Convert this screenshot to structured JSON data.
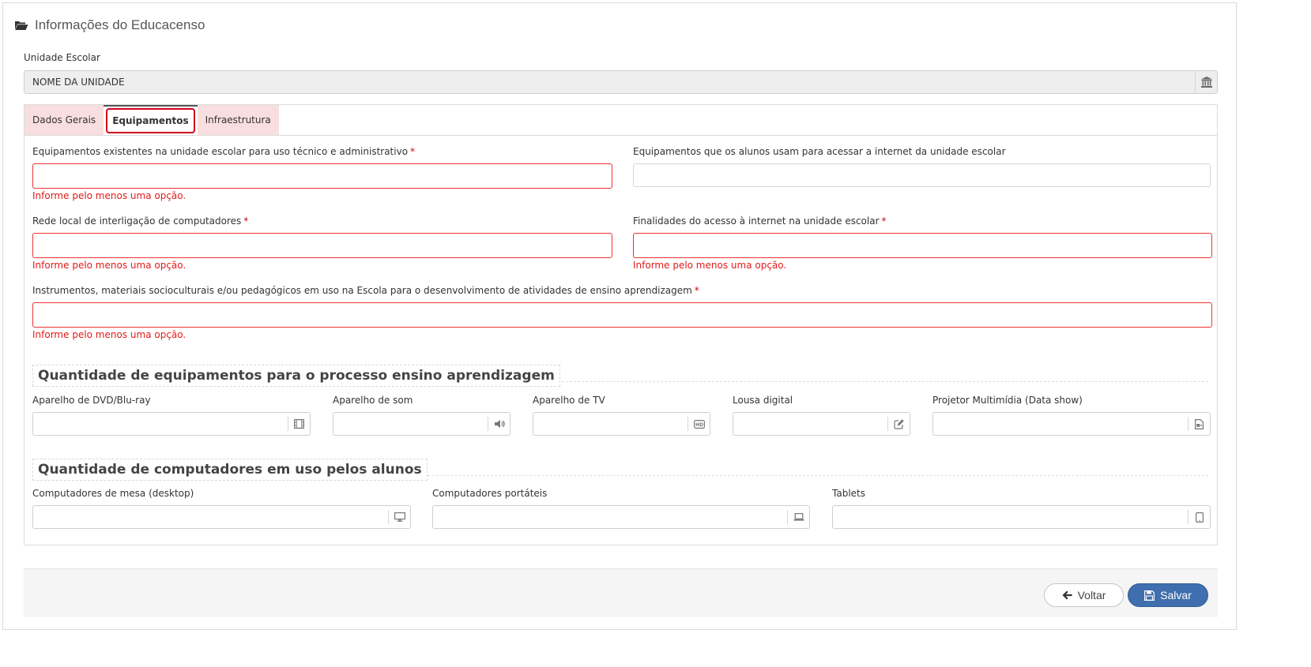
{
  "header": {
    "title": "Informações do Educacenso",
    "icon": "folder-open-icon"
  },
  "unit": {
    "label": "Unidade Escolar",
    "value": "NOME DA UNIDADE",
    "icon": "institution-icon"
  },
  "tabs": [
    {
      "label": "Dados Gerais",
      "active": false
    },
    {
      "label": "Equipamentos",
      "active": true
    },
    {
      "label": "Infraestrutura",
      "active": false
    }
  ],
  "fields": {
    "tech_admin": {
      "label": "Equipamentos existentes na unidade escolar para uso técnico e administrativo",
      "required": "*",
      "error": "Informe pelo menos uma opção."
    },
    "student_internet": {
      "label": "Equipamentos que os alunos usam para acessar a internet da unidade escolar"
    },
    "local_network": {
      "label": "Rede local de interligação de computadores",
      "required": "*",
      "error": "Informe pelo menos uma opção."
    },
    "internet_purpose": {
      "label": "Finalidades do acesso à internet na unidade escolar",
      "required": "*",
      "error": "Informe pelo menos uma opção."
    },
    "instruments": {
      "label": "Instrumentos, materiais socioculturais e/ou pedagógicos em uso na Escola para o desenvolvimento de atividades de ensino aprendizagem",
      "required": "*",
      "error": "Informe pelo menos uma opção."
    }
  },
  "section_equipment": {
    "title": "Quantidade de equipamentos para o processo ensino aprendizagem",
    "items": [
      {
        "label": "Aparelho de DVD/Blu-ray",
        "icon": "film-icon"
      },
      {
        "label": "Aparelho de som",
        "icon": "volume-icon"
      },
      {
        "label": "Aparelho de TV",
        "icon": "hd-video-icon"
      },
      {
        "label": "Lousa digital",
        "icon": "edit-icon"
      },
      {
        "label": "Projetor Multimídia (Data show)",
        "icon": "file-video-icon"
      }
    ]
  },
  "section_computers": {
    "title": "Quantidade de computadores em uso pelos alunos",
    "items": [
      {
        "label": "Computadores de mesa (desktop)",
        "icon": "desktop-icon"
      },
      {
        "label": "Computadores portáteis",
        "icon": "laptop-icon"
      },
      {
        "label": "Tablets",
        "icon": "tablet-icon"
      }
    ]
  },
  "footer": {
    "back_label": "Voltar",
    "save_label": "Salvar"
  },
  "colors": {
    "error": "#e21a1a",
    "tab_inactive_bg": "#f8dede",
    "primary": "#3f6fae"
  }
}
